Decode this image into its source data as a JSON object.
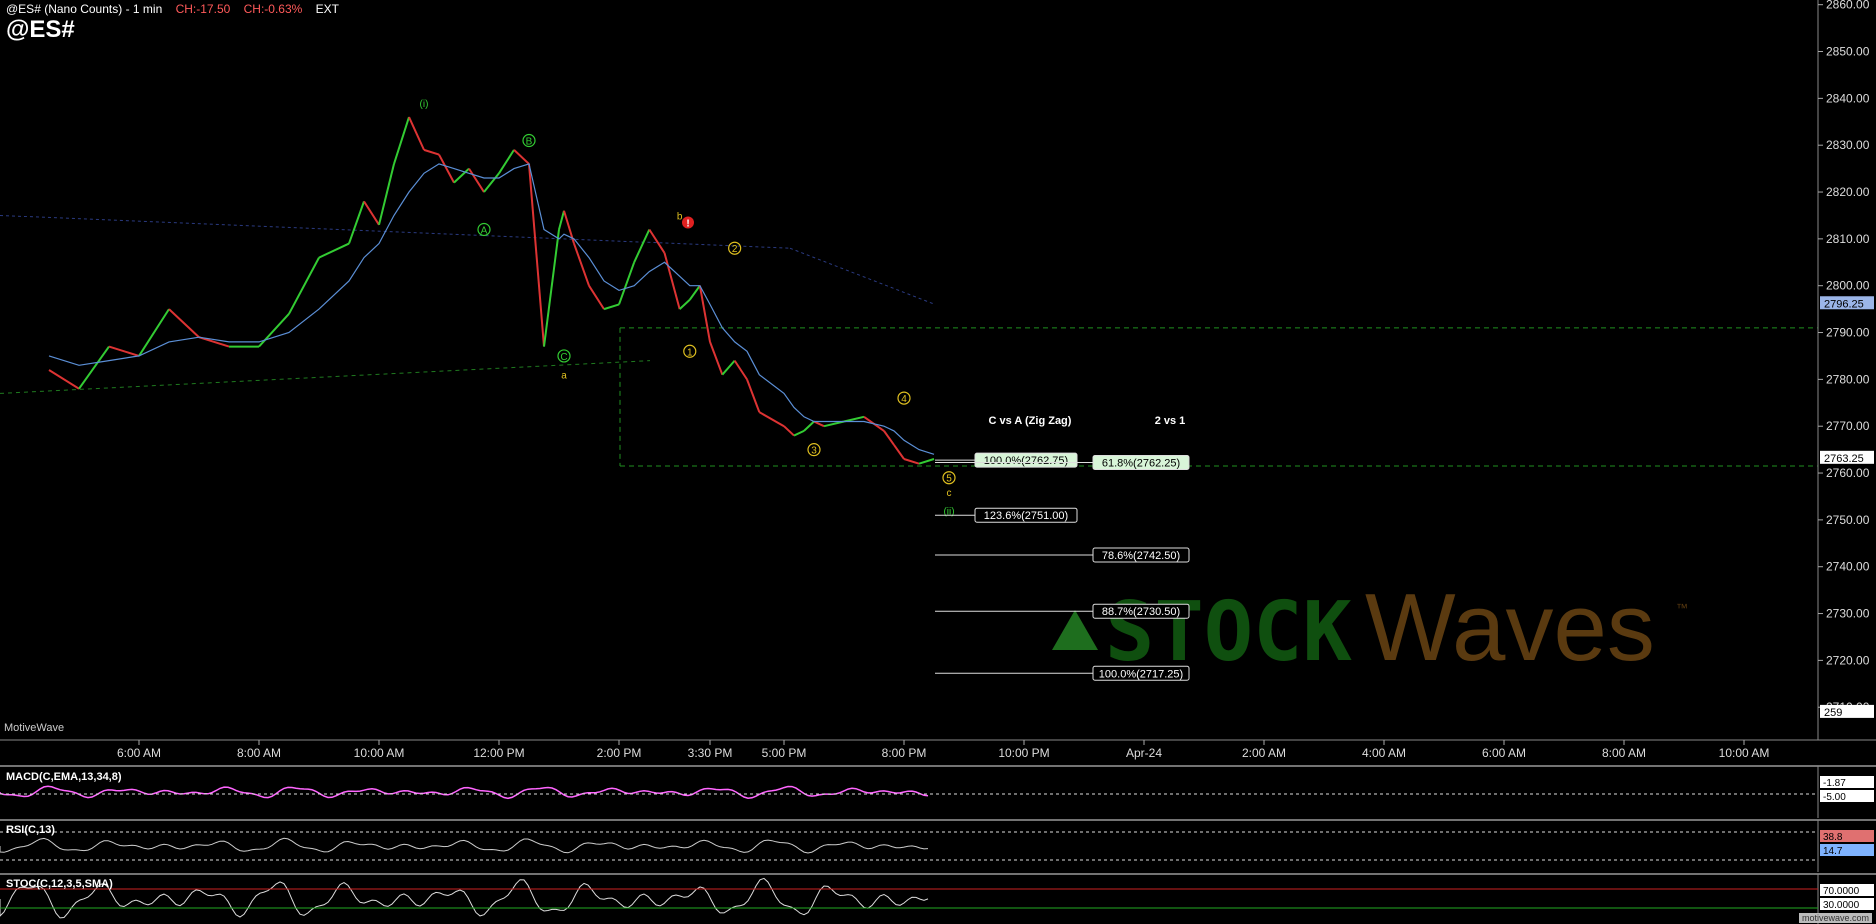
{
  "header": {
    "symbol_line": "@ES# (Nano Counts) - 1 min",
    "ch_points": "CH:-17.50",
    "ch_percent": "CH:-0.63%",
    "session": "EXT",
    "big_symbol": "@ES#"
  },
  "watermark": {
    "text": "MotiveWave",
    "credit": "motivewave.com",
    "logo_left": "STOCK",
    "logo_right": "Waves",
    "logo_tm": "™"
  },
  "colors": {
    "background": "#000000",
    "up_candle": "#33cc33",
    "down_candle": "#dd3333",
    "ma": "#5b8fd6",
    "fib_box_green": "#d8f5d8",
    "accent_green": "#2e8b2e"
  },
  "chart_data": {
    "type": "line",
    "title": "@ES# (Nano Counts) - 1 min",
    "y_axis": {
      "ticks": [
        2710,
        2720,
        2730,
        2740,
        2750,
        2760,
        2770,
        2780,
        2790,
        2800,
        2810,
        2820,
        2830,
        2840,
        2850,
        2860
      ],
      "tick_labels": [
        "2710.00",
        "2720.00",
        "2730.00",
        "2740.00",
        "2750.00",
        "2760.00",
        "2770.00",
        "2780.00",
        "2790.00",
        "2800.00",
        "2810.00",
        "2820.00",
        "2830.00",
        "2840.00",
        "2850.00",
        "2860.00"
      ],
      "ylim": [
        2703,
        2861
      ]
    },
    "x_axis": {
      "tick_labels": [
        "6:00 AM",
        "8:00 AM",
        "10:00 AM",
        "12:00 PM",
        "2:00 PM",
        "3:30 PM",
        "5:00 PM",
        "8:00 PM",
        "10:00 PM",
        "Apr-24",
        "2:00 AM",
        "4:00 AM",
        "6:00 AM",
        "8:00 AM",
        "10:00 AM"
      ]
    },
    "price_path": {
      "x": [
        "4:30 AM",
        "5:00 AM",
        "5:30 AM",
        "6:00 AM",
        "6:30 AM",
        "7:00 AM",
        "7:30 AM",
        "8:00 AM",
        "8:30 AM",
        "9:00 AM",
        "9:30 AM",
        "9:45 AM",
        "10:00 AM",
        "10:15 AM",
        "10:30 AM",
        "10:45 AM",
        "11:00 AM",
        "11:15 AM",
        "11:30 AM",
        "11:45 AM",
        "12:00 PM",
        "12:15 PM",
        "12:30 PM",
        "12:45 PM",
        "1:00 PM",
        "1:05 PM",
        "1:15 PM",
        "1:30 PM",
        "1:45 PM",
        "2:00 PM",
        "2:15 PM",
        "2:30 PM",
        "2:45 PM",
        "3:00 PM",
        "3:10 PM",
        "3:20 PM",
        "3:30 PM",
        "3:45 PM",
        "4:00 PM",
        "4:15 PM",
        "4:30 PM",
        "5:00 PM",
        "5:15 PM",
        "5:30 PM",
        "5:45 PM",
        "6:00 PM",
        "6:30 PM",
        "7:00 PM",
        "7:30 PM",
        "7:45 PM",
        "8:00 PM",
        "8:15 PM",
        "8:30 PM"
      ],
      "y": [
        2782,
        2778,
        2787,
        2785,
        2795,
        2789,
        2787,
        2787,
        2794,
        2806,
        2809,
        2818,
        2813,
        2826,
        2836,
        2829,
        2828,
        2822,
        2825,
        2820,
        2824,
        2829,
        2826,
        2787,
        2812,
        2816,
        2809,
        2800,
        2795,
        2796,
        2805,
        2812,
        2807,
        2795,
        2797,
        2800,
        2788,
        2781,
        2784,
        2780,
        2773,
        2770,
        2768,
        2769,
        2771,
        2770,
        2771,
        2772,
        2769,
        2766,
        2763,
        2762,
        2763
      ],
      "moving_average_y": [
        2785,
        2783,
        2784,
        2785,
        2788,
        2789,
        2788,
        2788,
        2790,
        2795,
        2801,
        2806,
        2809,
        2815,
        2820,
        2824,
        2826,
        2825,
        2824,
        2823,
        2823,
        2825,
        2826,
        2812,
        2810,
        2811,
        2810,
        2806,
        2801,
        2799,
        2800,
        2803,
        2805,
        2802,
        2800,
        2800,
        2796,
        2791,
        2788,
        2786,
        2781,
        2777,
        2774,
        2772,
        2771,
        2771,
        2771,
        2771,
        2770,
        2769,
        2767,
        2765,
        2764
      ]
    },
    "series": [],
    "price_tags": [
      {
        "label": "2796.25",
        "value": 2796.25
      },
      {
        "label": "2763.25",
        "value": 2763.25
      },
      {
        "label": "259",
        "value": 2709
      }
    ],
    "wave_labels": [
      {
        "text": "(i)",
        "time": "10:45 AM",
        "y": 2839,
        "color": "#33cc33"
      },
      {
        "text": "B",
        "time": "12:30 PM",
        "y": 2831,
        "color": "#33cc33",
        "circle": true
      },
      {
        "text": "A",
        "time": "11:45 AM",
        "y": 2812,
        "color": "#33cc33",
        "circle": true
      },
      {
        "text": "C",
        "time": "1:05 PM",
        "y": 2785,
        "color": "#33cc33",
        "circle": true
      },
      {
        "text": "a",
        "time": "1:05 PM",
        "y": 2781,
        "color": "#e0c020"
      },
      {
        "text": "b",
        "time": "3:00 PM",
        "y": 2815,
        "color": "#e0c020"
      },
      {
        "text": "2",
        "time": "4:00 PM",
        "y": 2808,
        "color": "#e0c020",
        "circle": true
      },
      {
        "text": "1",
        "time": "3:10 PM",
        "y": 2786,
        "color": "#e0c020",
        "circle": true
      },
      {
        "text": "3",
        "time": "5:45 PM",
        "y": 2765,
        "color": "#e0c020",
        "circle": true
      },
      {
        "text": "4",
        "time": "8:00 PM",
        "y": 2776,
        "color": "#e0c020",
        "circle": true
      },
      {
        "text": "5",
        "time": "8:45 PM",
        "y": 2759,
        "color": "#e0c020",
        "circle": true
      },
      {
        "text": "c",
        "time": "8:45 PM",
        "y": 2756,
        "color": "#e0c020"
      },
      {
        "text": "(ii)",
        "time": "8:45 PM",
        "y": 2752,
        "color": "#33cc33"
      }
    ],
    "projections": [
      {
        "group": "C vs A (Zig Zag)",
        "label": "100.0%(2762.75)",
        "value": 2762.75,
        "style": "green"
      },
      {
        "group": "C vs A (Zig Zag)",
        "label": "123.6%(2751.00)",
        "value": 2751.0,
        "style": "dark"
      },
      {
        "group": "2 vs 1",
        "label": "61.8%(2762.25)",
        "value": 2762.25,
        "style": "green"
      },
      {
        "group": "2 vs 1",
        "label": "78.6%(2742.50)",
        "value": 2742.5,
        "style": "dark"
      },
      {
        "group": "2 vs 1",
        "label": "88.7%(2730.50)",
        "value": 2730.5,
        "style": "dark"
      },
      {
        "group": "2 vs 1",
        "label": "100.0%(2717.25)",
        "value": 2717.25,
        "style": "dark"
      }
    ],
    "projection_titles": [
      "C vs A (Zig Zag)",
      "2 vs 1"
    ],
    "horizontal_levels": [
      2791,
      2761.5
    ]
  },
  "indicators": {
    "macd": {
      "label": "MACD(C,EMA,13,34,8)",
      "tags": [
        "-1.87",
        "-5.00"
      ]
    },
    "rsi": {
      "label": "RSI(C,13)",
      "tags": [
        "38.8",
        "14.7"
      ]
    },
    "stoch": {
      "label": "STOC(C,12,3,5,SMA)",
      "tags": [
        "70.0000",
        "30.0000"
      ]
    }
  }
}
